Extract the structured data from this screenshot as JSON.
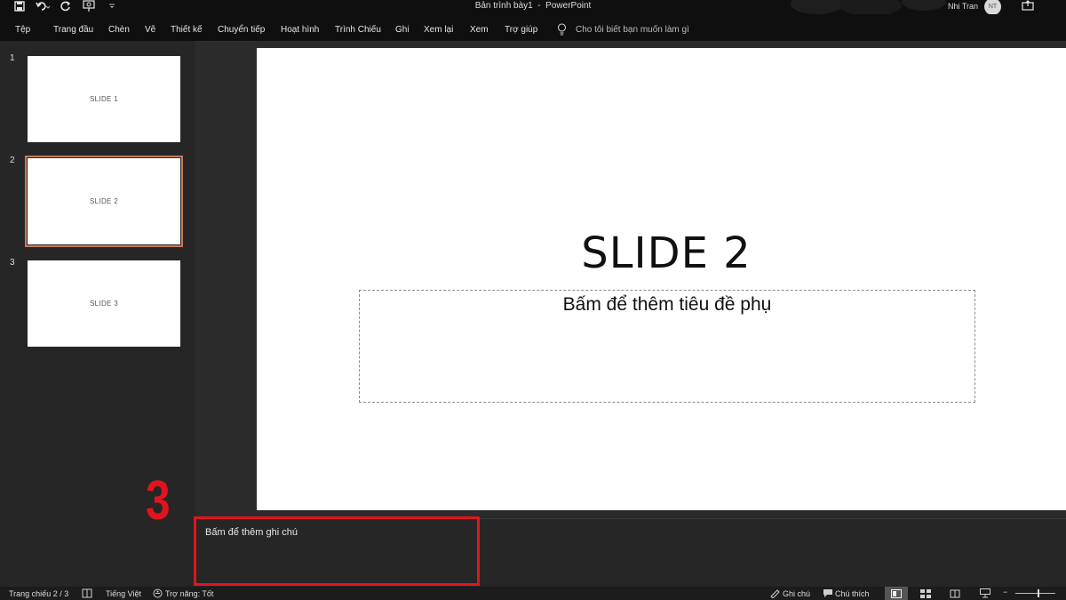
{
  "window": {
    "title": "Bản trình bày1  -  PowerPoint",
    "user_name": "Nhi Tran",
    "user_initials": "NT"
  },
  "quick_access": {
    "icons": [
      "save-icon",
      "undo-icon",
      "repeat-icon",
      "present-from-start-icon",
      "customize-dropdown-icon"
    ]
  },
  "ribbon": {
    "tabs": [
      "Tệp",
      "Trang đầu",
      "Chèn",
      "Vẽ",
      "Thiết kế",
      "Chuyển tiếp",
      "Hoạt hình",
      "Trình Chiếu",
      "Ghi",
      "Xem lại",
      "Xem",
      "Trợ giúp"
    ],
    "tell_me": "Cho tôi biết bạn muốn làm gì"
  },
  "thumbnails": [
    {
      "number": "1",
      "label": "SLIDE 1"
    },
    {
      "number": "2",
      "label": "SLIDE 2"
    },
    {
      "number": "3",
      "label": "SLIDE 3"
    }
  ],
  "selected_slide": 2,
  "slide": {
    "title": "SLIDE 2",
    "subtitle_placeholder": "Bấm để thêm tiêu đề phụ"
  },
  "notes": {
    "placeholder": "Bấm để thêm ghi chú"
  },
  "annotation": {
    "callout_number": "3",
    "color": "#e0141e"
  },
  "status_bar": {
    "slide_counter": "Trang chiếu 2 / 3",
    "language": "Tiếng Việt",
    "accessibility": "Trợ năng: Tốt",
    "notes_button": "Ghi chú",
    "comments_button": "Chú thích"
  },
  "colors": {
    "selection_outline": "#c77a5a",
    "chrome_dark": "#0f0f0f",
    "pane_bg": "#262626"
  }
}
